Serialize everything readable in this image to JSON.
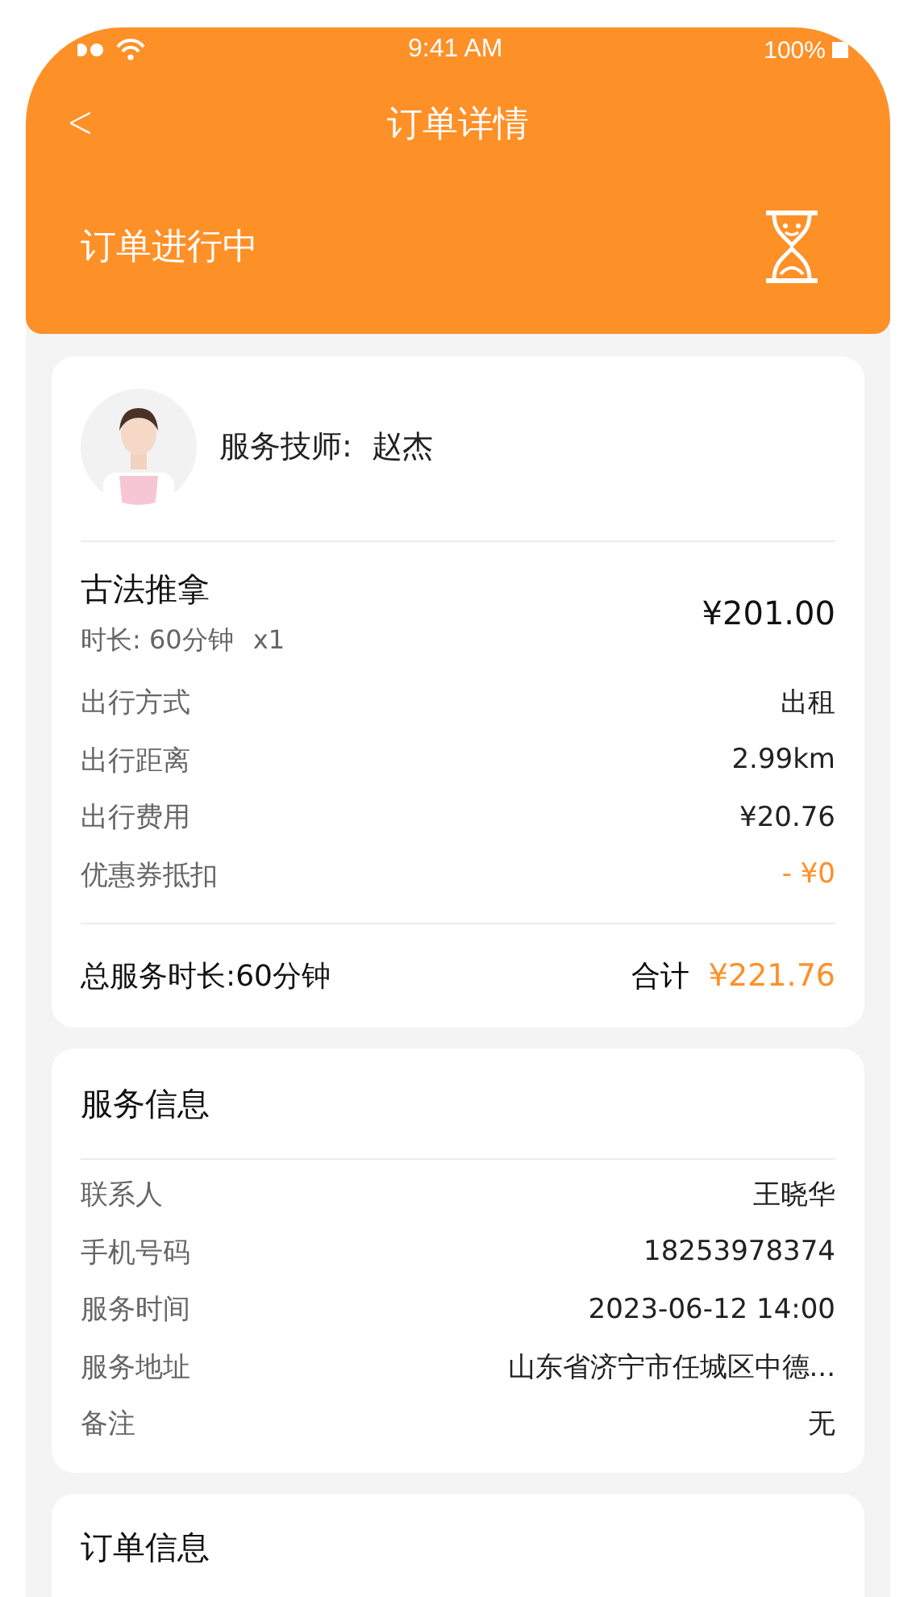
{
  "status_bar": {
    "time": "9:41 AM",
    "battery": "100%"
  },
  "nav": {
    "back": "<",
    "title": "订单详情"
  },
  "order_status": {
    "label": "订单进行中"
  },
  "technician": {
    "label": "服务技师:",
    "name": "赵杰"
  },
  "service": {
    "name": "古法推拿",
    "duration": "时长: 60分钟",
    "quantity": "x1",
    "price": "¥201.00"
  },
  "fees": [
    {
      "label": "出行方式",
      "value": "出租",
      "highlight": false
    },
    {
      "label": "出行距离",
      "value": "2.99km",
      "highlight": false
    },
    {
      "label": "出行费用",
      "value": "¥20.76",
      "highlight": false
    },
    {
      "label": "优惠券抵扣",
      "value": "- ¥0",
      "highlight": true
    }
  ],
  "summary": {
    "duration": "总服务时长:60分钟",
    "total_label": "合计",
    "total": "¥221.76"
  },
  "service_info": {
    "title": "服务信息",
    "rows": [
      {
        "label": "联系人",
        "value": "王晓华"
      },
      {
        "label": "手机号码",
        "value": "18253978374"
      },
      {
        "label": "服务时间",
        "value": "2023-06-12 14:00"
      },
      {
        "label": "服务地址",
        "value": "山东省济宁市任城区中德..."
      },
      {
        "label": "备注",
        "value": "无"
      }
    ]
  },
  "order_info": {
    "title": "订单信息"
  }
}
